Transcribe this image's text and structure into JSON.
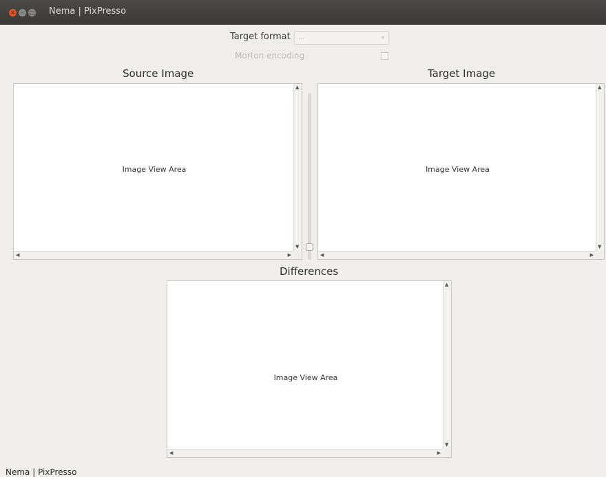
{
  "window": {
    "title": "Nema | PixPresso"
  },
  "controls": {
    "target_format_label": "Target format",
    "target_format_value": "...",
    "morton_label": "Morton encoding",
    "morton_checked": false
  },
  "views": {
    "source": {
      "heading": "Source Image",
      "placeholder": "Image View Area"
    },
    "target": {
      "heading": "Target Image",
      "placeholder": "Image View Area"
    },
    "diff": {
      "heading": "Differences",
      "placeholder": "Image View Area"
    }
  },
  "status_bar": {
    "text": "Nema | PixPresso"
  },
  "icons": [
    "close-icon",
    "minimize-icon",
    "maximize-icon",
    "arrow-up-icon",
    "arrow-down-icon",
    "arrow-left-icon",
    "arrow-right-icon"
  ],
  "colors": {
    "titlebar": "#3b3a36",
    "close_button": "#e95420",
    "window_bg": "#f0eeeb"
  }
}
